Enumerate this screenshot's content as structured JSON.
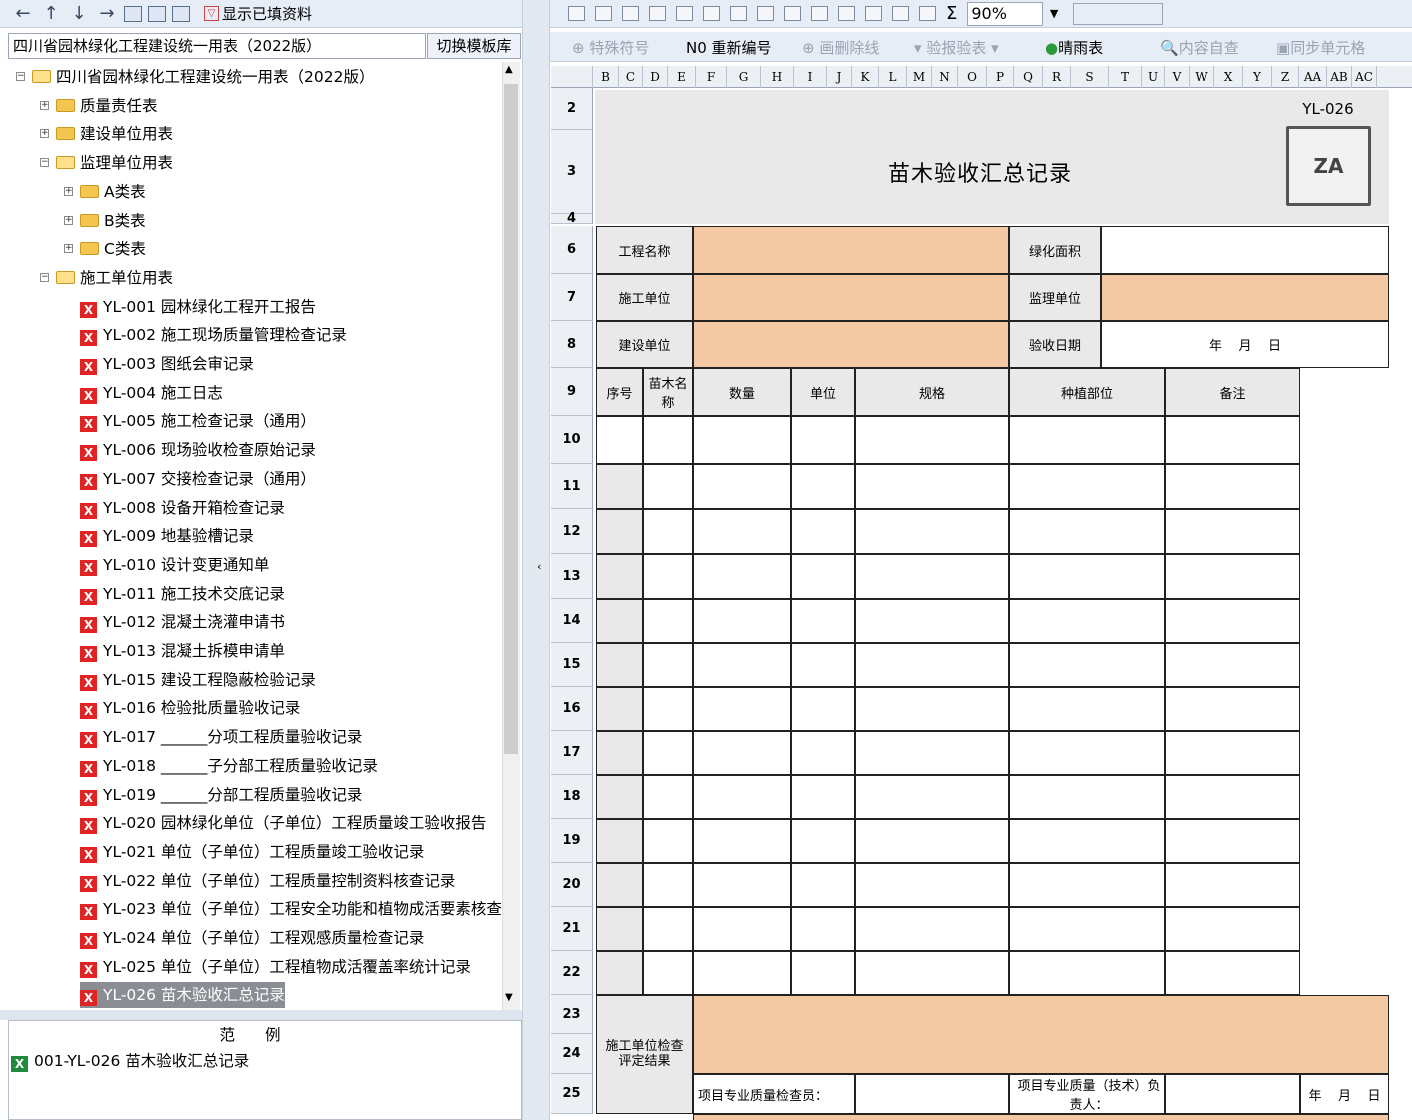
{
  "left_toolbar": {
    "show_filled_label": "显示已填资料"
  },
  "template_combo": {
    "value": "四川省园林绿化工程建设统一用表（2022版）"
  },
  "switch_template_label": "切换模板库",
  "tree": {
    "root": "四川省园林绿化工程建设统一用表（2022版）",
    "folders": [
      "质量责任表",
      "建设单位用表",
      "监理单位用表"
    ],
    "sub_folders": [
      "A类表",
      "B类表",
      "C类表"
    ],
    "construction_folder": "施工单位用表",
    "items": [
      "YL-001 园林绿化工程开工报告",
      "YL-002 施工现场质量管理检查记录",
      "YL-003 图纸会审记录",
      "YL-004 施工日志",
      "YL-005 施工检查记录（通用）",
      "YL-006 现场验收检查原始记录",
      "YL-007 交接检查记录（通用）",
      "YL-008 设备开箱检查记录",
      "YL-009 地基验槽记录",
      "YL-010 设计变更通知单",
      "YL-011 施工技术交底记录",
      "YL-012 混凝土浇灌申请书",
      "YL-013 混凝土拆模申请单",
      "YL-015 建设工程隐蔽检验记录",
      "YL-016 检验批质量验收记录",
      "YL-017 ______分项工程质量验收记录",
      "YL-018 ______子分部工程质量验收记录",
      "YL-019 ______分部工程质量验收记录",
      "YL-020 园林绿化单位（子单位）工程质量竣工验收报告",
      "YL-021 单位（子单位）工程质量竣工验收记录",
      "YL-022 单位（子单位）工程质量控制资料核查记录",
      "YL-023 单位（子单位）工程安全功能和植物成活要素核查",
      "YL-024 单位（子单位）工程观感质量检查记录",
      "YL-025 单位（子单位）工程植物成活覆盖率统计记录",
      "YL-026 苗木验收汇总记录"
    ]
  },
  "sample": {
    "header": "范例",
    "item": "001-YL-026 苗木验收汇总记录"
  },
  "right_toolbar": {
    "zoom": "90%",
    "special_symbol": "特殊符号",
    "renumber": "重新编号",
    "strike_line": "画删除线",
    "report_verify": "验报验表",
    "weather": "晴雨表",
    "self_check": "内容自查",
    "sync_cells": "同步单元格"
  },
  "columns": [
    "B",
    "C",
    "D",
    "E",
    "F",
    "G",
    "H",
    "I",
    "J",
    "K",
    "L",
    "M",
    "N",
    "O",
    "P",
    "Q",
    "R",
    "S",
    "T",
    "U",
    "V",
    "W",
    "X",
    "Y",
    "Z",
    "AA",
    "AB",
    "AC"
  ],
  "rows": [
    "2",
    "3",
    "4",
    "6",
    "7",
    "8",
    "9",
    "10",
    "11",
    "12",
    "13",
    "14",
    "15",
    "16",
    "17",
    "18",
    "19",
    "20",
    "21",
    "22",
    "23",
    "24",
    "25"
  ],
  "form": {
    "code": "YL-026",
    "logo_text": "ZA",
    "title": "苗木验收汇总记录",
    "project_name": "工程名称",
    "green_area": "绿化面积",
    "construction_unit": "施工单位",
    "supervision_unit": "监理单位",
    "builder_unit": "建设单位",
    "accept_date": "验收日期",
    "date_placeholder": "年    月    日",
    "headers": [
      "序号",
      "苗木名称",
      "数量",
      "单位",
      "规格",
      "种植部位",
      "备注"
    ],
    "result_label": "施工单位检查评定结果",
    "inspector": "项目专业质量检查员：",
    "tech_lead": "项目专业质量（技术）负责人：",
    "date_short": "年    月    日"
  }
}
